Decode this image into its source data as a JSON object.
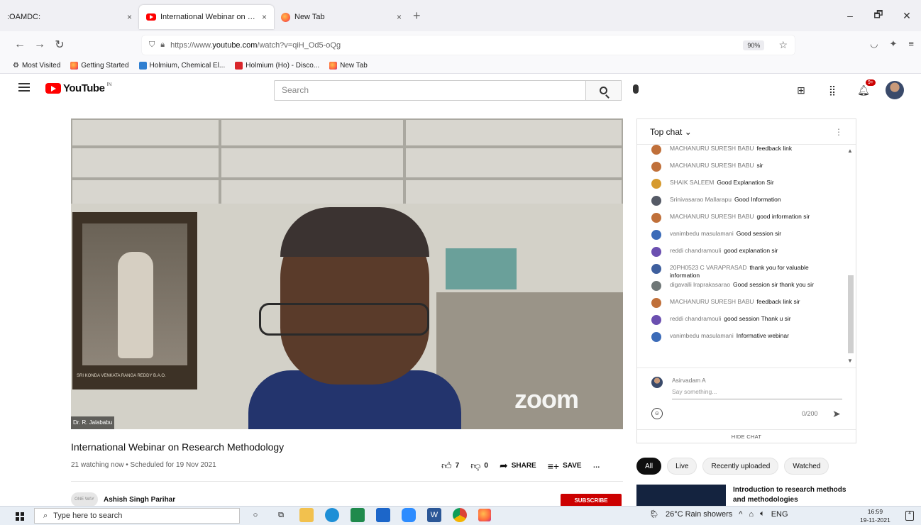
{
  "browser": {
    "tabs": [
      {
        "label": ":OAMDC:",
        "close": "×"
      },
      {
        "label": "International Webinar on Resea",
        "close": "×"
      },
      {
        "label": "New Tab",
        "close": "×"
      }
    ],
    "new_tab": "+",
    "window_controls": [
      "–",
      "🗗",
      "✕"
    ],
    "url_prefix": "https://www.",
    "url_domain": "youtube.com",
    "url_rest": "/watch?v=qiH_Od5-oQg",
    "zoom": "90%",
    "bookmarks": [
      "Most Visited",
      "Getting Started",
      "Holmium, Chemical El...",
      "Holmium (Ho) - Disco...",
      "New Tab"
    ]
  },
  "youtube": {
    "logo_text": "YouTube",
    "logo_sup": "IN",
    "search_placeholder": "Search",
    "notification_count": "9+"
  },
  "video": {
    "name_tag": "Dr. R. Jalababu",
    "watermark": "zoom",
    "portrait_caption": "SRI KONDA VENKATA RANGA REDDY B.A.O.",
    "title": "International Webinar on Research Methodology",
    "meta": "21 watching now • Scheduled for 19 Nov 2021",
    "likes": "7",
    "dislikes": "0",
    "share_label": "SHARE",
    "save_label": "SAVE",
    "more": "…",
    "channel_avatar_text": "ONE WAY",
    "channel_name": "Ashish Singh Parihar",
    "subscribe_label": "SUBSCRIBE"
  },
  "chat": {
    "header": "Top chat",
    "messages": [
      {
        "author": "MACHANURU SURESH BABU",
        "text": "feedback link",
        "color": "#c0703a"
      },
      {
        "author": "MACHANURU SURESH BABU",
        "text": "sir",
        "color": "#c0703a"
      },
      {
        "author": "SHAIK SALEEM",
        "text": "Good Explanation Sir",
        "color": "#d69a2e"
      },
      {
        "author": "Srinivasarao Mallarapu",
        "text": "Good Information",
        "color": "#555a66"
      },
      {
        "author": "MACHANURU SURESH BABU",
        "text": "good information sir",
        "color": "#c0703a"
      },
      {
        "author": "vanimbedu masulamani",
        "text": "Good session sir",
        "color": "#3b6bb8"
      },
      {
        "author": "reddi chandramouli",
        "text": "good explanation sir",
        "color": "#6b4fb0"
      },
      {
        "author": "20PH0523 C VARAPRASAD",
        "text": "thank you for valuable information",
        "color": "#3e5f9e"
      },
      {
        "author": "digavalli lraprakasarao",
        "text": "Good session sir thank you sir",
        "color": "#6f7777"
      },
      {
        "author": "MACHANURU SURESH BABU",
        "text": "feedback link sir",
        "color": "#c0703a"
      },
      {
        "author": "reddi chandramouli",
        "text": "good session Thank u sir",
        "color": "#6b4fb0"
      },
      {
        "author": "vanimbedu masulamani",
        "text": "Informative webinar",
        "color": "#3b6bb8"
      }
    ],
    "input_author": "Asirvadam A",
    "input_placeholder": "Say something...",
    "char_count": "0/200",
    "hide_chat": "HIDE CHAT"
  },
  "related": {
    "chips": [
      "All",
      "Live",
      "Recently uploaded",
      "Watched"
    ],
    "first_title": "Introduction to research methods and methodologies"
  },
  "taskbar": {
    "search_placeholder": "Type here to search",
    "weather": "26°C  Rain showers",
    "lang": "ENG",
    "time": "16:59",
    "date": "19-11-2021",
    "notify_count": "4"
  }
}
